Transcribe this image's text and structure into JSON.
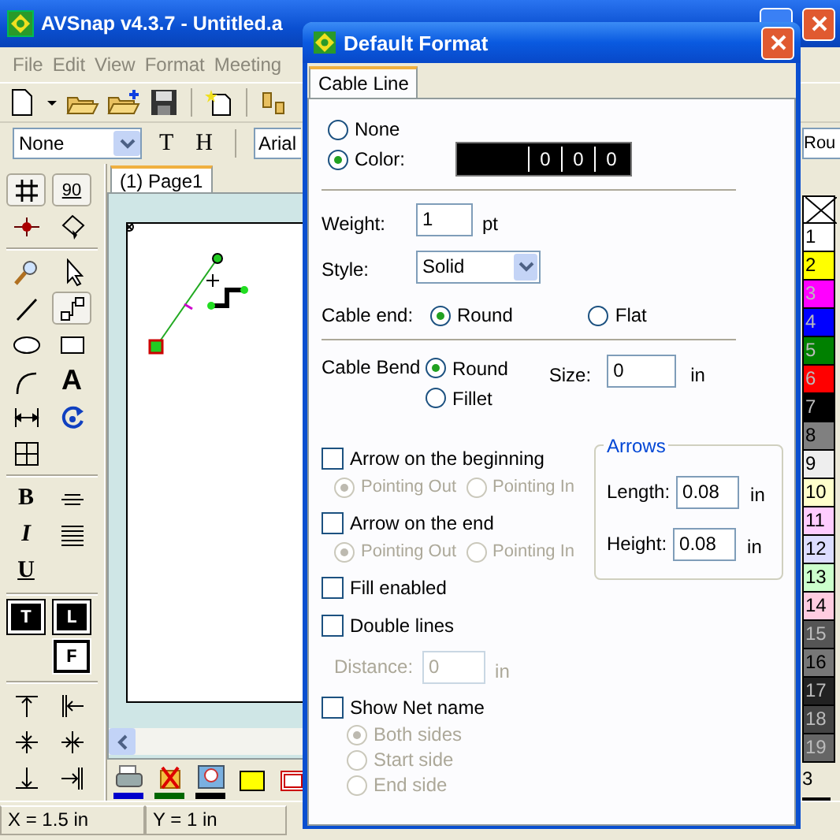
{
  "app": {
    "title": "AVSnap v4.3.7 - Untitled.a",
    "menu": [
      "File",
      "Edit",
      "View",
      "Format",
      "Meeting"
    ],
    "format_bar": {
      "style": "None",
      "buttons": [
        "T",
        "H"
      ],
      "font": "Arial",
      "right_combo": "Rou"
    },
    "toolbox": {
      "groups": [
        [
          {
            "kind": "grid",
            "selected": true
          },
          {
            "kind": "angle",
            "label": "90",
            "selected": true
          },
          {
            "kind": "point",
            "selected": false
          },
          {
            "kind": "node",
            "selected": false
          }
        ],
        [
          {
            "kind": "zoom",
            "selected": false
          },
          {
            "kind": "pointer",
            "selected": false
          },
          {
            "kind": "line",
            "selected": false
          },
          {
            "kind": "connector",
            "selected": true
          },
          {
            "kind": "ellipse",
            "selected": false
          },
          {
            "kind": "rectangle",
            "selected": false
          },
          {
            "kind": "arc",
            "selected": false
          },
          {
            "kind": "text",
            "label": "A",
            "selected": false
          },
          {
            "kind": "dimension",
            "selected": false
          },
          {
            "kind": "rotate",
            "selected": false
          },
          {
            "kind": "table",
            "selected": false
          }
        ],
        [
          {
            "kind": "bold",
            "label": "B",
            "selected": false
          },
          {
            "kind": "strike",
            "selected": false
          },
          {
            "kind": "italic",
            "label": "I",
            "selected": false
          },
          {
            "kind": "justify",
            "selected": false
          },
          {
            "kind": "underline",
            "label": "U",
            "selected": false
          }
        ],
        [
          {
            "kind": "layer",
            "label": "T",
            "selected": true
          },
          {
            "kind": "layer",
            "label": "L",
            "selected": true
          },
          {
            "kind": "layer",
            "label": "F",
            "selected": false
          }
        ],
        [
          {
            "kind": "align-top",
            "selected": false
          },
          {
            "kind": "align-left",
            "selected": false
          },
          {
            "kind": "center-v",
            "selected": false
          },
          {
            "kind": "center-h",
            "selected": false
          },
          {
            "kind": "align-bottom",
            "selected": false
          },
          {
            "kind": "align-right",
            "selected": false
          }
        ]
      ]
    },
    "page_tabs": [
      {
        "label": "(1) Page1",
        "selected": true
      }
    ],
    "bottom_tools": [
      {
        "kind": "printer",
        "color": "#0000cc"
      },
      {
        "kind": "mail",
        "color": "#006600"
      },
      {
        "kind": "picture-zoom",
        "color": "#000000"
      },
      {
        "kind": "fill",
        "color": "#ffff00"
      },
      {
        "kind": "border",
        "color": "#cc0000"
      }
    ],
    "palette": [
      {
        "kind": "none"
      },
      {
        "kind": "color",
        "label": "1",
        "color": "#ffffff"
      },
      {
        "kind": "color",
        "label": "2",
        "color": "#ffff00"
      },
      {
        "kind": "color",
        "label": "3",
        "color": "#ff00ff"
      },
      {
        "kind": "color",
        "label": "4",
        "color": "#0000ff"
      },
      {
        "kind": "color",
        "label": "5",
        "color": "#008000"
      },
      {
        "kind": "color",
        "label": "6",
        "color": "#ff0000"
      },
      {
        "kind": "color",
        "label": "7",
        "color": "#000000"
      },
      {
        "kind": "color",
        "label": "8",
        "color": "#808080"
      },
      {
        "kind": "color",
        "label": "9",
        "color": "#eeeeee"
      },
      {
        "kind": "color",
        "label": "10",
        "color": "#ffffcc"
      },
      {
        "kind": "color",
        "label": "11",
        "color": "#ffccff"
      },
      {
        "kind": "color",
        "label": "12",
        "color": "#ddddff"
      },
      {
        "kind": "color",
        "label": "13",
        "color": "#ccffcc"
      },
      {
        "kind": "color",
        "label": "14",
        "color": "#ffcce0"
      },
      {
        "kind": "color",
        "label": "15",
        "color": "#555555"
      },
      {
        "kind": "color",
        "label": "16",
        "color": "#777777"
      },
      {
        "kind": "color",
        "label": "17",
        "color": "#222222"
      },
      {
        "kind": "color",
        "label": "18",
        "color": "#444444"
      },
      {
        "kind": "color",
        "label": "19",
        "color": "#666666"
      }
    ],
    "palette_footer": "3",
    "status_bar": [
      "X = 1.5 in",
      "Y = 1 in"
    ]
  },
  "dialog": {
    "title": "Default Format",
    "tabs": [
      {
        "label": "Cable Line",
        "selected": true
      }
    ],
    "line_color": {
      "options": [
        {
          "label": "None",
          "selected": false
        },
        {
          "label": "Color:",
          "selected": true
        }
      ],
      "color": "#000000",
      "rgb": [
        "0",
        "0",
        "0"
      ]
    },
    "weight": {
      "label": "Weight:",
      "value": "1",
      "unit": "pt"
    },
    "style": {
      "label": "Style:",
      "value": "Solid"
    },
    "cable_end": {
      "label": "Cable end:",
      "options": [
        {
          "label": "Round",
          "selected": true
        },
        {
          "label": "Flat",
          "selected": false
        }
      ]
    },
    "cable_bend": {
      "label": "Cable Bend",
      "options": [
        {
          "label": "Round",
          "selected": true
        },
        {
          "label": "Fillet",
          "selected": false
        }
      ],
      "size_label": "Size:",
      "size": "0",
      "unit": "in"
    },
    "options": [
      {
        "kind": "arrow",
        "label": "Arrow on the beginning",
        "checked": false,
        "choices": [
          {
            "label": "Pointing Out",
            "selected": true,
            "disabled": true
          },
          {
            "label": "Pointing In",
            "selected": false,
            "disabled": true
          }
        ]
      },
      {
        "kind": "arrow",
        "label": "Arrow on the end",
        "checked": false,
        "choices": [
          {
            "label": "Pointing Out",
            "selected": true,
            "disabled": true
          },
          {
            "label": "Pointing In",
            "selected": false,
            "disabled": true
          }
        ]
      },
      {
        "kind": "plain",
        "label": "Fill enabled",
        "checked": false
      },
      {
        "kind": "distance",
        "label": "Double lines",
        "checked": false,
        "field": {
          "label": "Distance:",
          "value": "0",
          "unit": "in",
          "disabled": true
        }
      },
      {
        "kind": "net",
        "label": "Show Net name",
        "checked": false,
        "choices": [
          {
            "label": "Both sides",
            "selected": true,
            "disabled": true
          },
          {
            "label": "Start side",
            "selected": false,
            "disabled": true
          },
          {
            "label": "End side",
            "selected": false,
            "disabled": true
          }
        ]
      }
    ],
    "arrows": {
      "title": "Arrows",
      "fields": [
        {
          "label": "Length:",
          "value": "0.08",
          "unit": "in"
        },
        {
          "label": "Height:",
          "value": "0.08",
          "unit": "in"
        }
      ]
    }
  }
}
